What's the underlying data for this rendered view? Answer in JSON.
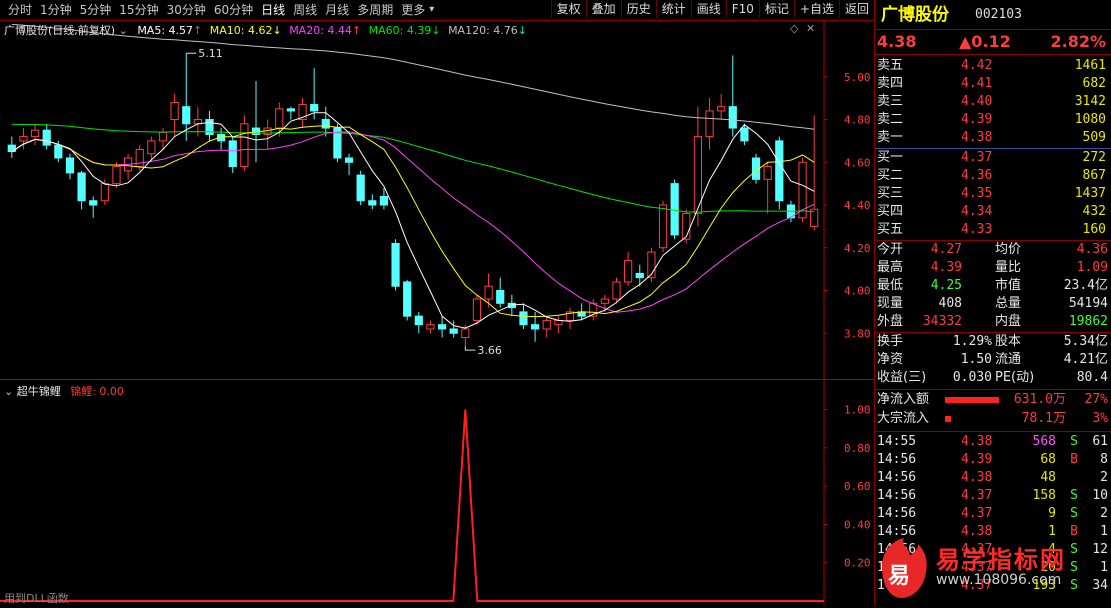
{
  "toolbar": {
    "periods": [
      "分时",
      "1分钟",
      "5分钟",
      "15分钟",
      "30分钟",
      "60分钟",
      "日线",
      "周线",
      "月线",
      "多周期",
      "更多"
    ],
    "active_period": "日线",
    "buttons": [
      "复权",
      "叠加",
      "历史",
      "统计",
      "画线",
      "F10",
      "标记",
      "+自选",
      "返回"
    ]
  },
  "main_legend": {
    "title": "广博股份(日线,前复权)",
    "ma5": "MA5: 4.57",
    "ma10": "MA10: 4.62",
    "ma20": "MA20: 4.44",
    "ma60": "MA60: 4.39",
    "ma120": "MA120: 4.76",
    "high_label": "5.11",
    "low_label": "3.66"
  },
  "indicator_legend": {
    "title": "超牛锦鲤",
    "value": "锦鲤: 0.00",
    "footer": "用到DLL函数"
  },
  "colors": {
    "up": "#ff3c3c",
    "down": "#54ffff",
    "ma5": "#ffffff",
    "ma10": "#ffff00",
    "ma20": "#ff40ff",
    "ma60": "#00e600",
    "ma120": "#c0c0c0",
    "axis": "#b40000"
  },
  "chart_data": [
    {
      "type": "candlestick",
      "title": "广博股份(日线,前复权)",
      "ylim": [
        3.6,
        5.2
      ],
      "y_ticks": [
        "5.00",
        "4.80",
        "4.60",
        "4.40",
        "4.20",
        "4.00",
        "3.80"
      ],
      "candles": [
        [
          4.68,
          4.72,
          4.62,
          4.65
        ],
        [
          4.7,
          4.76,
          4.66,
          4.72
        ],
        [
          4.72,
          4.78,
          4.68,
          4.75
        ],
        [
          4.75,
          4.78,
          4.66,
          4.68
        ],
        [
          4.68,
          4.7,
          4.6,
          4.62
        ],
        [
          4.62,
          4.64,
          4.52,
          4.55
        ],
        [
          4.55,
          4.56,
          4.38,
          4.42
        ],
        [
          4.42,
          4.44,
          4.34,
          4.4
        ],
        [
          4.42,
          4.52,
          4.4,
          4.5
        ],
        [
          4.5,
          4.6,
          4.48,
          4.58
        ],
        [
          4.56,
          4.64,
          4.52,
          4.62
        ],
        [
          4.58,
          4.68,
          4.56,
          4.66
        ],
        [
          4.64,
          4.72,
          4.6,
          4.7
        ],
        [
          4.7,
          4.76,
          4.66,
          4.74
        ],
        [
          4.8,
          4.92,
          4.72,
          4.88
        ],
        [
          4.86,
          5.11,
          4.7,
          4.78
        ],
        [
          4.78,
          4.86,
          4.72,
          4.8
        ],
        [
          4.8,
          4.84,
          4.7,
          4.73
        ],
        [
          4.73,
          4.76,
          4.66,
          4.7
        ],
        [
          4.7,
          4.72,
          4.55,
          4.58
        ],
        [
          4.58,
          4.82,
          4.56,
          4.78
        ],
        [
          4.76,
          4.98,
          4.6,
          4.73
        ],
        [
          4.73,
          4.8,
          4.66,
          4.76
        ],
        [
          4.76,
          4.88,
          4.72,
          4.85
        ],
        [
          4.85,
          4.86,
          4.8,
          4.84
        ],
        [
          4.8,
          4.9,
          4.76,
          4.87
        ],
        [
          4.87,
          5.04,
          4.8,
          4.84
        ],
        [
          4.8,
          4.86,
          4.72,
          4.76
        ],
        [
          4.76,
          4.78,
          4.6,
          4.62
        ],
        [
          4.62,
          4.64,
          4.54,
          4.6
        ],
        [
          4.54,
          4.56,
          4.4,
          4.42
        ],
        [
          4.42,
          4.45,
          4.38,
          4.4
        ],
        [
          4.44,
          4.48,
          4.38,
          4.4
        ],
        [
          4.22,
          4.24,
          4.0,
          4.02
        ],
        [
          4.04,
          4.05,
          3.86,
          3.88
        ],
        [
          3.88,
          3.9,
          3.8,
          3.84
        ],
        [
          3.82,
          3.86,
          3.8,
          3.84
        ],
        [
          3.84,
          3.88,
          3.78,
          3.82
        ],
        [
          3.82,
          3.86,
          3.78,
          3.8
        ],
        [
          3.78,
          3.84,
          3.74,
          3.82
        ],
        [
          3.86,
          3.98,
          3.84,
          3.96
        ],
        [
          3.96,
          4.08,
          3.92,
          4.02
        ],
        [
          4.0,
          4.06,
          3.92,
          3.94
        ],
        [
          3.94,
          3.98,
          3.88,
          3.92
        ],
        [
          3.9,
          3.94,
          3.82,
          3.84
        ],
        [
          3.84,
          3.9,
          3.76,
          3.82
        ],
        [
          3.82,
          3.88,
          3.78,
          3.86
        ],
        [
          3.84,
          3.88,
          3.8,
          3.86
        ],
        [
          3.86,
          3.92,
          3.82,
          3.9
        ],
        [
          3.9,
          3.94,
          3.86,
          3.88
        ],
        [
          3.88,
          3.96,
          3.86,
          3.94
        ],
        [
          3.94,
          3.98,
          3.9,
          3.96
        ],
        [
          3.96,
          4.06,
          3.94,
          4.04
        ],
        [
          4.04,
          4.18,
          4.02,
          4.14
        ],
        [
          4.08,
          4.12,
          4.02,
          4.06
        ],
        [
          4.06,
          4.2,
          4.04,
          4.18
        ],
        [
          4.2,
          4.42,
          4.18,
          4.4
        ],
        [
          4.5,
          4.52,
          4.24,
          4.26
        ],
        [
          4.24,
          4.38,
          4.22,
          4.36
        ],
        [
          4.36,
          4.86,
          4.3,
          4.72
        ],
        [
          4.72,
          4.9,
          4.66,
          4.84
        ],
        [
          4.84,
          4.92,
          4.8,
          4.86
        ],
        [
          4.86,
          5.1,
          4.72,
          4.76
        ],
        [
          4.76,
          4.78,
          4.68,
          4.7
        ],
        [
          4.62,
          4.64,
          4.5,
          4.52
        ],
        [
          4.52,
          4.6,
          4.36,
          4.58
        ],
        [
          4.7,
          4.72,
          4.38,
          4.42
        ],
        [
          4.4,
          4.42,
          4.32,
          4.34
        ],
        [
          4.34,
          4.62,
          4.32,
          4.6
        ],
        [
          4.3,
          4.82,
          4.28,
          4.38
        ]
      ]
    },
    {
      "type": "line",
      "title": "超牛锦鲤",
      "series": [
        {
          "name": "锦鲤",
          "values_note": "0 except single spike to 1.00"
        }
      ],
      "spike_index": 39,
      "ylim": [
        0,
        1.05
      ],
      "y_ticks": [
        "1.00",
        "0.80",
        "0.60",
        "0.40",
        "0.20"
      ]
    }
  ],
  "panel": {
    "name": "广博股份",
    "code": "002103",
    "price": "4.38",
    "change": "▲0.12",
    "change_pct": "2.82%",
    "asks": [
      {
        "label": "卖五",
        "price": "4.42",
        "vol": "1461"
      },
      {
        "label": "卖四",
        "price": "4.41",
        "vol": "682"
      },
      {
        "label": "卖三",
        "price": "4.40",
        "vol": "3142"
      },
      {
        "label": "卖二",
        "price": "4.39",
        "vol": "1080"
      },
      {
        "label": "卖一",
        "price": "4.38",
        "vol": "509"
      }
    ],
    "bids": [
      {
        "label": "买一",
        "price": "4.37",
        "vol": "272"
      },
      {
        "label": "买二",
        "price": "4.36",
        "vol": "867"
      },
      {
        "label": "买三",
        "price": "4.35",
        "vol": "1437"
      },
      {
        "label": "买四",
        "price": "4.34",
        "vol": "432"
      },
      {
        "label": "买五",
        "price": "4.33",
        "vol": "160"
      }
    ],
    "stats": [
      {
        "l1": "今开",
        "v1": "4.27",
        "c1": "red",
        "l2": "均价",
        "v2": "4.36",
        "c2": "red"
      },
      {
        "l1": "最高",
        "v1": "4.39",
        "c1": "red",
        "l2": "量比",
        "v2": "1.09",
        "c2": "red"
      },
      {
        "l1": "最低",
        "v1": "4.25",
        "c1": "green",
        "l2": "市值",
        "v2": "23.4亿",
        "c2": "white"
      },
      {
        "l1": "现量",
        "v1": "408",
        "c1": "white",
        "l2": "总量",
        "v2": "54194",
        "c2": "white"
      },
      {
        "l1": "外盘",
        "v1": "34332",
        "c1": "red",
        "l2": "内盘",
        "v2": "19862",
        "c2": "green"
      }
    ],
    "stats2": [
      {
        "l1": "换手",
        "v1": "1.29%",
        "l2": "股本",
        "v2": "5.34亿"
      },
      {
        "l1": "净资",
        "v1": "1.50",
        "l2": "流通",
        "v2": "4.21亿"
      },
      {
        "l1": "收益(三)",
        "v1": "0.030",
        "l2": "PE(动)",
        "v2": "80.4"
      }
    ],
    "flow": [
      {
        "label": "净流入额",
        "value": "631.0万",
        "pct": "27%",
        "bar": 0.27
      },
      {
        "label": "大宗流入",
        "value": "78.1万",
        "pct": "3%",
        "bar": 0.03
      }
    ],
    "trades": [
      {
        "time": "14:55",
        "price": "4.38",
        "vol": "568",
        "flag": "S",
        "n": "61",
        "vcol": "magenta"
      },
      {
        "time": "14:56",
        "price": "4.39",
        "vol": "68",
        "flag": "B",
        "n": "8",
        "vcol": "yellow"
      },
      {
        "time": "14:56",
        "price": "4.38",
        "vol": "48",
        "flag": "",
        "n": "2",
        "vcol": "yellow"
      },
      {
        "time": "14:56",
        "price": "4.37",
        "vol": "158",
        "flag": "S",
        "n": "10",
        "vcol": "yellow"
      },
      {
        "time": "14:56",
        "price": "4.37",
        "vol": "9",
        "flag": "S",
        "n": "2",
        "vcol": "yellow"
      },
      {
        "time": "14:56",
        "price": "4.38",
        "vol": "1",
        "flag": "B",
        "n": "1",
        "vcol": "yellow"
      },
      {
        "time": "14:56",
        "price": "4.37",
        "vol": "4",
        "flag": "S",
        "n": "12",
        "vcol": "yellow"
      },
      {
        "time": "14:56",
        "price": "4.37",
        "vol": "20",
        "flag": "S",
        "n": "1",
        "vcol": "yellow"
      },
      {
        "time": "14:57",
        "price": "4.37",
        "vol": "193",
        "flag": "S",
        "n": "34",
        "vcol": "yellow"
      }
    ]
  },
  "watermark": {
    "logo_char": "易",
    "title": "易学指标网",
    "url": "www.108096.com"
  }
}
